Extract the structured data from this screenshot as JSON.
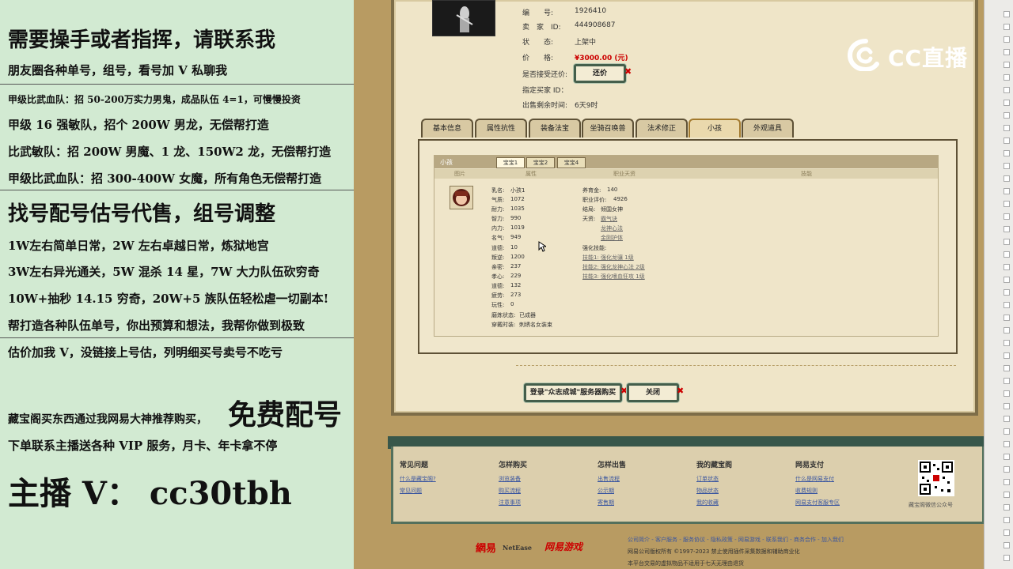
{
  "overlay": {
    "l1": "需要操手或者指挥，请联系我",
    "l2": "朋友圈各种单号，组号，看号加 V 私聊我",
    "l3": "甲级比武血队：招 50-200万实力男鬼，成品队伍 4=1，可慢慢投资",
    "l4": "甲级 16 强敏队，招个 200W 男龙，无偿帮打造",
    "l5": "比武敏队：招 200W 男魔、1 龙、150W2 龙，无偿帮打造",
    "l6": "甲级比武血队：招 300-400W 女魔，所有角色无偿帮打造",
    "l7": "找号配号估号代售，组号调整",
    "l8": "1W左右简单日常，2W 左右卓越日常，炼狱地宫",
    "l9": "3W左右异光通关，5W 混杀 14 星，7W 大力队伍砍穷奇",
    "l10": "10W+抽秒 14.15 穷奇，20W+5 族队伍轻松虐一切副本!",
    "l11": "帮打造各种队伍单号，你出预算和想法，我帮你做到极致",
    "l12": "估价加我 V，没链接上号估，列明细买号卖号不吃亏",
    "l13a": "藏宝阁买东西通过我网易大神推荐购买，",
    "l13b": "免费配号",
    "l14": "下单联系主播送各种 VIP 服务，月卡、年卡拿不停",
    "l15": "主播 V： cc30tbh"
  },
  "watermark": "CC直播",
  "listing": {
    "id_label": "编　　号:",
    "id_value": "1926410",
    "seller_label": "卖　家　ID:",
    "seller_value": "444908687",
    "status_label": "状　　态:",
    "status_value": "上架中",
    "price_label": "价　　格:",
    "price_value": "¥3000.00 (元)",
    "bargain_label": "是否接受还价:",
    "bargain_button": "还价",
    "buyer_label": "指定买家 ID：",
    "time_label": "出售剩余时间:",
    "time_value": "6天9时"
  },
  "tabs": [
    "基本信息",
    "属性抗性",
    "装备法宝",
    "坐骑召唤兽",
    "法术修正",
    "小孩",
    "外观道具"
  ],
  "panel": {
    "title": "小孩",
    "subtabs": [
      "宝宝1",
      "宝宝2",
      "宝宝4"
    ],
    "cols": [
      "图片",
      "属性",
      "职业天资",
      "技能"
    ],
    "stats": [
      [
        "乳名:",
        "小孩1"
      ],
      [
        "气质:",
        "1072"
      ],
      [
        "耐力:",
        "1035"
      ],
      [
        "智力:",
        "990"
      ],
      [
        "内力:",
        "1019"
      ],
      [
        "名气:",
        "949"
      ],
      [
        "道德:",
        "10"
      ],
      [
        "叛逆:",
        "1200"
      ],
      [
        "亲密:",
        "237"
      ],
      [
        "孝心:",
        "229"
      ],
      [
        "道德:",
        "132"
      ],
      [
        "疲劳:",
        "273"
      ],
      [
        "玩性:",
        "0"
      ],
      [
        "磨炼状态:",
        "已成器"
      ],
      [
        "穿戴时装:",
        "刺绣名女装束"
      ]
    ],
    "right": {
      "yangyu_label": "养育金:",
      "yangyu_value": "140",
      "eval_label": "职业评价:",
      "eval_value": "4926",
      "ending_label": "结局:",
      "ending_value": "倾国女神",
      "talent_label": "天资:",
      "talents": [
        "霸气诀",
        "龙神心法",
        "金刚护体"
      ],
      "skill_label": "强化技能:",
      "skills": [
        "技能1: 强化龙骧 1级",
        "技能2: 强化龙神心法 2级",
        "技能3: 强化嗜血狂攻 1级"
      ]
    }
  },
  "actions": {
    "buy": "登录\"众志成城\"服务器购买",
    "close": "关闭"
  },
  "footer": {
    "cols": [
      {
        "head": "常见问题",
        "links": [
          "什么是藏宝阁?",
          "常见问题"
        ]
      },
      {
        "head": "怎样购买",
        "links": [
          "浏览装备",
          "购买流程",
          "注意事项"
        ]
      },
      {
        "head": "怎样出售",
        "links": [
          "出售流程",
          "公示期",
          "寄售期"
        ]
      },
      {
        "head": "我的藏宝阁",
        "links": [
          "订单状态",
          "物品状态",
          "我的收藏"
        ]
      },
      {
        "head": "网易支付",
        "links": [
          "什么是网易支付",
          "收费规则",
          "网易支付客服专区"
        ]
      }
    ],
    "qr_caption": "藏宝阁微信公众号",
    "brand1": "網易",
    "brand2": "NetEase",
    "brand3": "网易游戏",
    "links": "公司简介 - 客户服务 - 服务协议 - 隐私政策 - 网易游戏 - 联系我们 - 商务合作 - 加入我们",
    "copy1": "网易公司版权所有 ©1997-2023 禁止使用插件采集数据和辅助商业化",
    "copy2": "本平台交易的虚拟物品不适用于七天无理由退货"
  }
}
